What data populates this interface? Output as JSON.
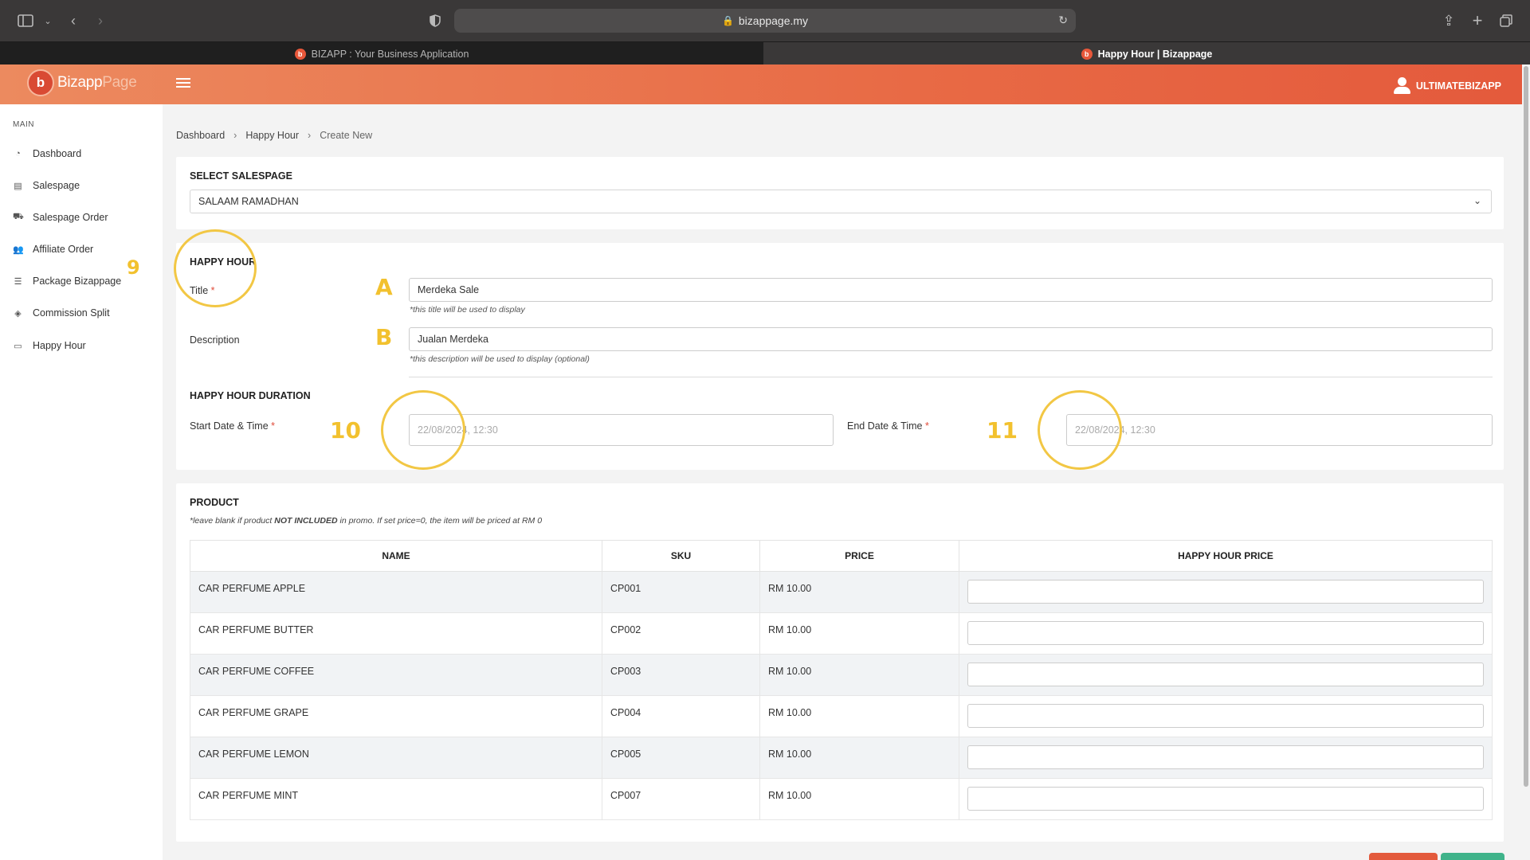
{
  "browser": {
    "url": "bizappage.my",
    "tabs": [
      {
        "label": "BIZAPP : Your Business Application",
        "active": false
      },
      {
        "label": "Happy Hour | Bizappage",
        "active": true
      }
    ]
  },
  "app": {
    "logo_main": "Bizapp",
    "logo_accent": "Page",
    "user_name": "ULTIMATEBIZAPP",
    "brand_color": "#e86a45"
  },
  "sidebar": {
    "section_label": "MAIN",
    "items": [
      {
        "label": "Dashboard",
        "icon": "dashboard-icon"
      },
      {
        "label": "Salespage",
        "icon": "salespage-icon"
      },
      {
        "label": "Salespage Order",
        "icon": "cart-icon"
      },
      {
        "label": "Affiliate Order",
        "icon": "users-icon"
      },
      {
        "label": "Package Bizappage",
        "icon": "list-icon"
      },
      {
        "label": "Commission Split",
        "icon": "split-icon"
      },
      {
        "label": "Happy Hour",
        "icon": "ticket-icon"
      }
    ]
  },
  "breadcrumb": [
    "Dashboard",
    "Happy Hour",
    "Create New"
  ],
  "salespage": {
    "title": "SELECT SALESPAGE",
    "selected": "SALAAM RAMADHAN"
  },
  "happy_hour": {
    "title": "HAPPY HOUR",
    "title_label": "Title",
    "title_value": "Merdeka Sale",
    "title_hint": "*this title will be used to display",
    "description_label": "Description",
    "description_value": "Jualan Merdeka",
    "description_hint": "*this description will be used to display (optional)"
  },
  "duration": {
    "title": "HAPPY HOUR DURATION",
    "start_label": "Start Date & Time",
    "start_placeholder": "22/08/2024, 12:30",
    "end_label": "End Date & Time",
    "end_placeholder": "22/08/2024, 12:30"
  },
  "product": {
    "title": "PRODUCT",
    "note_prefix": "*leave blank if product ",
    "note_bold": "NOT INCLUDED",
    "note_suffix": " in promo. If set price=0, the item will be priced at RM 0",
    "columns": [
      "NAME",
      "SKU",
      "PRICE",
      "HAPPY HOUR PRICE"
    ],
    "rows": [
      {
        "name": "CAR PERFUME APPLE",
        "sku": "CP001",
        "price": "RM 10.00"
      },
      {
        "name": "CAR PERFUME BUTTER",
        "sku": "CP002",
        "price": "RM 10.00"
      },
      {
        "name": "CAR PERFUME COFFEE",
        "sku": "CP003",
        "price": "RM 10.00"
      },
      {
        "name": "CAR PERFUME GRAPE",
        "sku": "CP004",
        "price": "RM 10.00"
      },
      {
        "name": "CAR PERFUME LEMON",
        "sku": "CP005",
        "price": "RM 10.00"
      },
      {
        "name": "CAR PERFUME MINT",
        "sku": "CP007",
        "price": "RM 10.00"
      }
    ]
  },
  "annotations": {
    "n9": "9",
    "a": "A",
    "b": "B",
    "n10": "10",
    "n11": "11",
    "color": "#f2c12e"
  }
}
